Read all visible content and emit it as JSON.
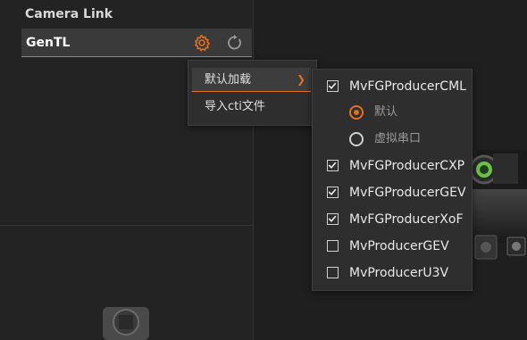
{
  "left_panel": {
    "section_title": "Camera Link",
    "gentl": {
      "label": "GenTL",
      "icons": [
        "gear-icon",
        "refresh-icon"
      ]
    }
  },
  "context_menu": {
    "items": [
      {
        "label": "默认加载",
        "has_submenu": true,
        "active": true
      },
      {
        "label": "导入cti文件",
        "has_submenu": false,
        "active": false
      }
    ]
  },
  "submenu": {
    "items": [
      {
        "type": "checkbox",
        "label": "MvFGProducerCML",
        "checked": true
      },
      {
        "type": "radio",
        "label": "默认",
        "selected": true
      },
      {
        "type": "radio",
        "label": "虚拟串口",
        "selected": false
      },
      {
        "type": "checkbox",
        "label": "MvFGProducerCXP",
        "checked": true
      },
      {
        "type": "checkbox",
        "label": "MvFGProducerGEV",
        "checked": true
      },
      {
        "type": "checkbox",
        "label": "MvFGProducerXoF",
        "checked": true
      },
      {
        "type": "checkbox",
        "label": "MvProducerGEV",
        "checked": false
      },
      {
        "type": "checkbox",
        "label": "MvProducerU3V",
        "checked": false
      }
    ]
  },
  "colors": {
    "accent": "#e07020",
    "panel_bg": "#232323",
    "menu_bg": "#2e2e2e"
  }
}
